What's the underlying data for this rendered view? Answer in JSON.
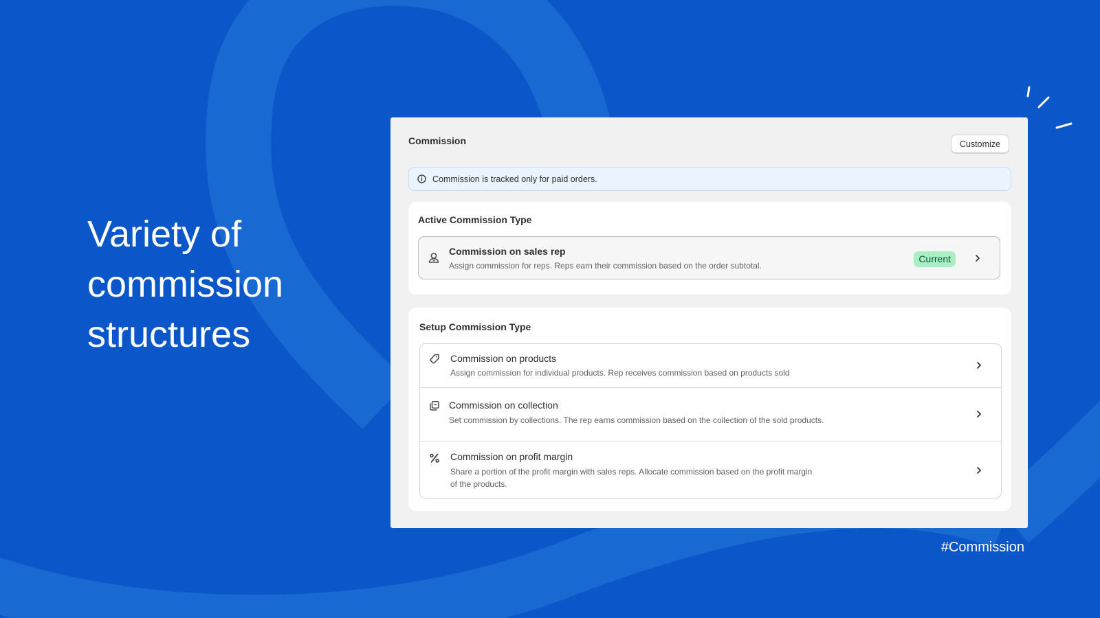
{
  "headline": {
    "line1": "Variety of",
    "line2": "commission",
    "line3": "structures"
  },
  "hashtag": "#Commission",
  "colors": {
    "background": "#0b57c9",
    "decoration": "#1f6fd6",
    "badge_bg": "#a8f0c4",
    "badge_text": "#0c5132",
    "banner_bg": "#eaf4ff"
  },
  "panel": {
    "title": "Commission",
    "customize_label": "Customize",
    "banner": {
      "icon": "info-icon",
      "text": "Commission is tracked only for paid orders."
    },
    "active_section": {
      "heading": "Active Commission Type",
      "item": {
        "icon": "user-icon",
        "title": "Commission on sales rep",
        "description": "Assign commission for reps. Reps earn their commission based on the order subtotal.",
        "badge": "Current"
      }
    },
    "setup_section": {
      "heading": "Setup Commission Type",
      "items": [
        {
          "icon": "tag-icon",
          "title": "Commission on products",
          "description": "Assign commission for individual products. Rep receives commission based on products sold"
        },
        {
          "icon": "collection-icon",
          "title": "Commission on collection",
          "description": "Set commission by collections. The rep earns commission based on the collection of the sold products."
        },
        {
          "icon": "percent-icon",
          "title": "Commission on profit margin",
          "description_line1": "Share a portion of the profit margin with sales reps. Allocate commission based on the profit margin",
          "description_line2": "of the products."
        }
      ]
    }
  }
}
